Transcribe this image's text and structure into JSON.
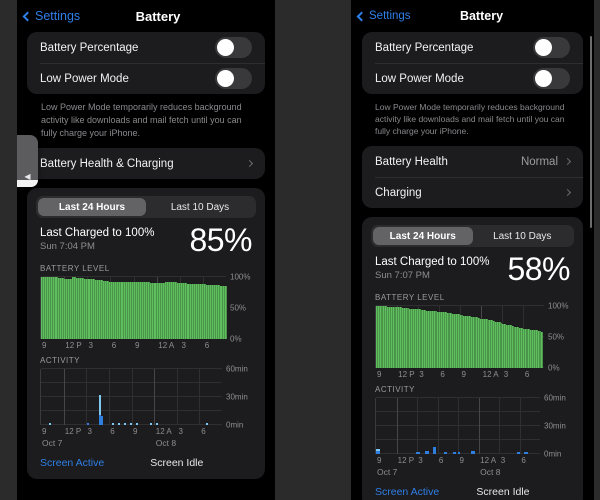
{
  "meta": {
    "background": "#2b2b2b",
    "accent_blue": "#2f7fe8",
    "battery_green": "#5fbf5f",
    "screen_active_blue": "#2f7fe0",
    "screen_idle_blue": "#7ec8f0"
  },
  "left": {
    "nav": {
      "back_label": "Settings",
      "title": "Battery"
    },
    "toggles": [
      {
        "label": "Battery Percentage",
        "state": "off"
      },
      {
        "label": "Low Power Mode",
        "state": "off"
      }
    ],
    "footnote": "Low Power Mode temporarily reduces background activity like downloads and mail fetch until you can fully charge your iPhone.",
    "links": [
      {
        "label": "Battery Health & Charging",
        "value": ""
      }
    ],
    "segmented": {
      "options": [
        "Last 24 Hours",
        "Last 10 Days"
      ],
      "selected": "Last 24 Hours"
    },
    "charged": {
      "title": "Last Charged to 100%",
      "subtitle": "Sun 7:04 PM",
      "percent": "85%"
    },
    "legend": {
      "active": "Screen Active",
      "idle": "Screen Idle"
    },
    "volume_hud": {
      "icon": "speaker-icon",
      "level": 13
    },
    "chart_data": [
      {
        "type": "area",
        "title": "BATTERY LEVEL",
        "ylabel": "",
        "ylim": [
          0,
          100
        ],
        "yticks": [
          "0%",
          "50%",
          "100%"
        ],
        "xticks": [
          "9",
          "12 P",
          "3",
          "6",
          "9",
          "12 A",
          "3",
          "6"
        ],
        "grid": true,
        "values": [
          100,
          100,
          100,
          100,
          99,
          99,
          99,
          99,
          98,
          98,
          98,
          97,
          97,
          97,
          97,
          99,
          99,
          98,
          98,
          98,
          98,
          97,
          97,
          97,
          96,
          96,
          95,
          95,
          94,
          94,
          93,
          93,
          93,
          92,
          92,
          92,
          92,
          92,
          92,
          92,
          91,
          91,
          91,
          91,
          91,
          91,
          91,
          91,
          91,
          91,
          91,
          91,
          91,
          90,
          90,
          90,
          90,
          90,
          90,
          90,
          92,
          92,
          91,
          91,
          91,
          91,
          90,
          90,
          90,
          90,
          90,
          89,
          89,
          89,
          89,
          88,
          88,
          88,
          88,
          88,
          87,
          87,
          87,
          86,
          86,
          86,
          86,
          85,
          85,
          85
        ]
      },
      {
        "type": "bar",
        "title": "ACTIVITY",
        "ylim": [
          0,
          60
        ],
        "yticks": [
          "0min",
          "30min",
          "60min"
        ],
        "xticks": [
          "9",
          "12 P",
          "3",
          "6",
          "9",
          "12 A",
          "3",
          "6"
        ],
        "day_labels": [
          "Oct 7",
          "Oct 8"
        ],
        "grid": true,
        "series": [
          {
            "name": "Screen Active",
            "color": "#2f7fe0",
            "values": [
              0,
              0,
              0,
              0,
              0,
              0,
              0,
              0,
              0,
              0,
              0,
              0,
              0,
              0,
              0,
              0,
              0,
              0,
              0,
              0,
              0,
              0,
              0,
              2,
              0,
              0,
              0,
              0,
              0,
              10,
              9,
              0,
              0,
              0,
              0,
              0,
              0,
              0,
              0,
              0,
              0,
              0,
              0,
              0,
              0,
              0,
              0,
              0,
              0,
              0,
              0,
              0,
              0,
              0,
              0,
              0,
              0,
              0,
              0,
              0,
              0,
              0,
              0,
              0,
              0,
              0,
              0,
              0,
              0,
              0,
              0,
              0,
              0,
              0,
              0,
              0,
              0,
              0,
              0,
              0,
              0,
              0,
              0,
              0,
              0,
              0,
              0,
              0,
              0,
              0
            ]
          },
          {
            "name": "Screen Idle",
            "color": "#7ec8f0",
            "values": [
              0,
              0,
              0,
              0,
              2,
              0,
              0,
              0,
              0,
              0,
              0,
              0,
              0,
              0,
              0,
              0,
              0,
              0,
              0,
              0,
              0,
              0,
              0,
              0,
              0,
              0,
              0,
              0,
              0,
              22,
              0,
              0,
              0,
              0,
              0,
              2,
              0,
              0,
              2,
              0,
              0,
              2,
              0,
              0,
              2,
              0,
              0,
              2,
              0,
              0,
              0,
              0,
              0,
              0,
              2,
              0,
              0,
              2,
              0,
              0,
              0,
              0,
              0,
              0,
              0,
              0,
              0,
              0,
              0,
              0,
              0,
              0,
              0,
              0,
              0,
              0,
              0,
              0,
              0,
              0,
              0,
              0,
              2,
              0,
              0,
              0,
              0,
              0,
              0,
              0
            ]
          }
        ]
      }
    ]
  },
  "right": {
    "nav": {
      "back_label": "Settings",
      "title": "Battery"
    },
    "toggles": [
      {
        "label": "Battery Percentage",
        "state": "off"
      },
      {
        "label": "Low Power Mode",
        "state": "off"
      }
    ],
    "footnote": "Low Power Mode temporarily reduces background activity like downloads and mail fetch until you can fully charge your iPhone.",
    "links": [
      {
        "label": "Battery Health",
        "value": "Normal"
      },
      {
        "label": "Charging",
        "value": ""
      }
    ],
    "segmented": {
      "options": [
        "Last 24 Hours",
        "Last 10 Days"
      ],
      "selected": "Last 24 Hours"
    },
    "charged": {
      "title": "Last Charged to 100%",
      "subtitle": "Sun 7:07 PM",
      "percent": "58%"
    },
    "legend": {
      "active": "Screen Active",
      "idle": "Screen Idle"
    },
    "chart_data": [
      {
        "type": "area",
        "title": "BATTERY LEVEL",
        "ylim": [
          0,
          100
        ],
        "yticks": [
          "0%",
          "50%",
          "100%"
        ],
        "xticks": [
          "9",
          "12 P",
          "3",
          "6",
          "9",
          "12 A",
          "3",
          "6"
        ],
        "grid": true,
        "values": [
          100,
          100,
          100,
          99,
          99,
          99,
          98,
          98,
          98,
          98,
          97,
          97,
          97,
          97,
          96,
          96,
          96,
          96,
          95,
          95,
          95,
          94,
          94,
          94,
          93,
          93,
          93,
          92,
          92,
          92,
          91,
          91,
          91,
          90,
          90,
          90,
          89,
          89,
          88,
          88,
          88,
          87,
          87,
          86,
          86,
          85,
          85,
          84,
          84,
          83,
          83,
          82,
          82,
          81,
          81,
          80,
          79,
          79,
          78,
          78,
          77,
          76,
          76,
          75,
          74,
          73,
          73,
          72,
          71,
          70,
          69,
          68,
          68,
          67,
          66,
          66,
          65,
          64,
          64,
          63,
          63,
          62,
          62,
          61,
          61,
          60,
          60,
          59,
          59,
          58
        ]
      },
      {
        "type": "bar",
        "title": "ACTIVITY",
        "ylim": [
          0,
          60
        ],
        "yticks": [
          "0min",
          "30min",
          "60min"
        ],
        "xticks": [
          "9",
          "12 P",
          "3",
          "6",
          "9",
          "12 A",
          "3",
          "6"
        ],
        "day_labels": [
          "Oct 7",
          "Oct 8"
        ],
        "grid": true,
        "series": [
          {
            "name": "Screen Active",
            "color": "#2f7fe0",
            "values": [
              3,
              3,
              0,
              0,
              0,
              0,
              0,
              0,
              0,
              0,
              0,
              0,
              0,
              0,
              0,
              0,
              0,
              0,
              0,
              0,
              0,
              0,
              2,
              2,
              0,
              0,
              0,
              3,
              3,
              0,
              0,
              7,
              7,
              0,
              0,
              0,
              0,
              2,
              2,
              0,
              0,
              0,
              2,
              2,
              0,
              2,
              0,
              0,
              0,
              0,
              0,
              0,
              3,
              3,
              0,
              0,
              0,
              0,
              0,
              0,
              0,
              0,
              0,
              0,
              0,
              0,
              0,
              0,
              0,
              0,
              0,
              0,
              0,
              0,
              0,
              0,
              0,
              2,
              2,
              0,
              0,
              2,
              2,
              0,
              0,
              0,
              0,
              0,
              0,
              0
            ]
          },
          {
            "name": "Screen Idle",
            "color": "#7ec8f0",
            "values": [
              2,
              2,
              0,
              0,
              0,
              0,
              0,
              0,
              0,
              0,
              0,
              0,
              0,
              0,
              0,
              0,
              0,
              0,
              0,
              0,
              0,
              0,
              0,
              0,
              0,
              0,
              0,
              0,
              0,
              0,
              0,
              0,
              0,
              0,
              0,
              0,
              0,
              0,
              0,
              0,
              0,
              0,
              0,
              0,
              0,
              0,
              0,
              0,
              0,
              0,
              0,
              0,
              0,
              0,
              0,
              0,
              0,
              0,
              0,
              0,
              0,
              0,
              0,
              0,
              0,
              0,
              0,
              0,
              0,
              0,
              0,
              0,
              0,
              0,
              0,
              0,
              0,
              0,
              0,
              0,
              0,
              0,
              0,
              0,
              0,
              0,
              0,
              0,
              0,
              0
            ]
          }
        ]
      }
    ]
  }
}
